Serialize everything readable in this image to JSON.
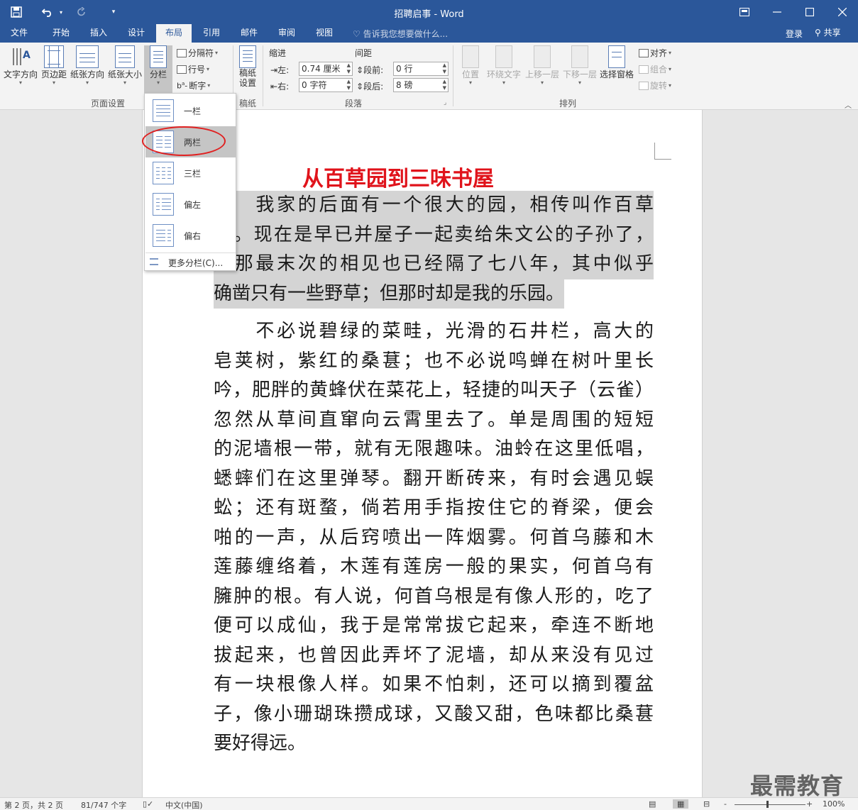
{
  "window": {
    "title": "招聘启事 - Word",
    "minimize_icon": "minimize-icon",
    "maximize_icon": "maximize-icon",
    "close_icon": "close-icon",
    "ribbon_options_icon": "ribbon-display-options-icon"
  },
  "quick_access": {
    "save_icon": "save-icon",
    "undo_icon": "undo-icon",
    "redo_icon": "redo-icon",
    "customize_icon": "customize-qat-icon"
  },
  "tabs": [
    {
      "label": "文件"
    },
    {
      "label": "开始"
    },
    {
      "label": "插入"
    },
    {
      "label": "设计"
    },
    {
      "label": "布局"
    },
    {
      "label": "引用"
    },
    {
      "label": "邮件"
    },
    {
      "label": "审阅"
    },
    {
      "label": "视图"
    }
  ],
  "active_tab": "布局",
  "tell_me": "告诉我您想要做什么...",
  "login": "登录",
  "share": "共享",
  "ribbon": {
    "page_setup": {
      "group_label": "页面设置",
      "text_direction": "文字方向",
      "margins": "页边距",
      "orientation": "纸张方向",
      "size": "纸张大小",
      "columns": "分栏",
      "breaks": "分隔符",
      "line_numbers": "行号",
      "hyphenation": "断字"
    },
    "manuscript": {
      "group_label": "稿纸",
      "button_line1": "稿纸",
      "button_line2": "设置"
    },
    "paragraph": {
      "group_label": "段落",
      "indent_label": "缩进",
      "spacing_label": "间距",
      "left_label": "左:",
      "left_value": "0.74 厘米",
      "right_label": "右:",
      "right_value": "0 字符",
      "before_label": "段前:",
      "before_value": "0 行",
      "after_label": "段后:",
      "after_value": "8 磅"
    },
    "arrange": {
      "group_label": "排列",
      "position": "位置",
      "wrap_text": "环绕文字",
      "bring_forward": "上移一层",
      "send_backward": "下移一层",
      "selection_pane": "选择窗格",
      "align": "对齐",
      "group": "组合",
      "rotate": "旋转"
    }
  },
  "columns_menu": {
    "items": [
      {
        "label": "一栏"
      },
      {
        "label": "两栏"
      },
      {
        "label": "三栏"
      },
      {
        "label": "偏左"
      },
      {
        "label": "偏右"
      }
    ],
    "highlighted": "两栏",
    "more": "更多分栏(C)..."
  },
  "document": {
    "title": "从百草园到三味书屋",
    "paragraph1": [
      "　　我家的后面有一个很大的园，相传叫作百草",
      "园。现在是早已并屋子一起卖给朱文公的子孙了，",
      "连那最末次的相见也已经隔了七八年，其中似乎",
      "确凿只有一些野草；但那时却是我的乐园。"
    ],
    "paragraph2": [
      "　　不必说碧绿的菜畦，光滑的石井栏，高大的",
      "皂荚树，紫红的桑葚；也不必说鸣蝉在树叶里长",
      "吟，肥胖的黄蜂伏在菜花上，轻捷的叫天子（云雀）",
      "忽然从草间直窜向云霄里去了。单是周围的短短",
      "的泥墙根一带，就有无限趣味。油蛉在这里低唱，",
      "蟋蟀们在这里弹琴。翻开断砖来，有时会遇见蜈",
      "蚣；还有斑蝥，倘若用手指按住它的脊梁，便会",
      "啪的一声，从后窍喷出一阵烟雾。何首乌藤和木",
      "莲藤缠络着，木莲有莲房一般的果实，何首乌有",
      "臃肿的根。有人说，何首乌根是有像人形的，吃了",
      "便可以成仙，我于是常常拔它起来，牵连不断地",
      "拔起来，也曾因此弄坏了泥墙，却从来没有见过",
      "有一块根像人样。如果不怕刺，还可以摘到覆盆",
      "子，像小珊瑚珠攒成球，又酸又甜，色味都比桑葚",
      "要好得远。"
    ]
  },
  "statusbar": {
    "page": "第 2 页，共 2 页",
    "words": "81/747 个字",
    "language": "中文(中国)",
    "zoom": "100%",
    "zoom_minus": "-",
    "zoom_plus": "+"
  },
  "watermark": "最需教育",
  "colors": {
    "brand": "#2b579a",
    "title_red": "#e0131b",
    "selection": "#d4d4d4",
    "annotation": "#e02020"
  }
}
